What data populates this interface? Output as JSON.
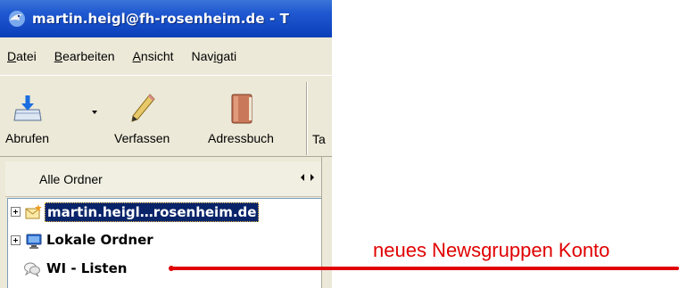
{
  "window": {
    "title": "martin.heigl@fh-rosenheim.de - T"
  },
  "menu": [
    {
      "label": "Datei"
    },
    {
      "label": "Bearbeiten"
    },
    {
      "label": "Ansicht"
    },
    {
      "label": "Navigati"
    }
  ],
  "toolbar": {
    "get_label": "Abrufen",
    "compose_label": "Verfassen",
    "addressbook_label": "Adressbuch",
    "cut_label": "Ta"
  },
  "folder_pane": {
    "header": "Alle Ordner",
    "items": [
      {
        "label": "martin.heigl…rosenheim.de",
        "icon": "mail-account-new-icon",
        "selected": true
      },
      {
        "label": "Lokale Ordner",
        "icon": "local-folders-icon"
      },
      {
        "label": "WI - Listen",
        "icon": "newsgroup-account-icon"
      }
    ]
  },
  "annotation": {
    "text": "neues Newsgruppen Konto",
    "color": "#e00000"
  },
  "colors": {
    "titlebar": "#0a3fb9",
    "window_bg": "#ece9d8",
    "selection": "#0a246a"
  }
}
